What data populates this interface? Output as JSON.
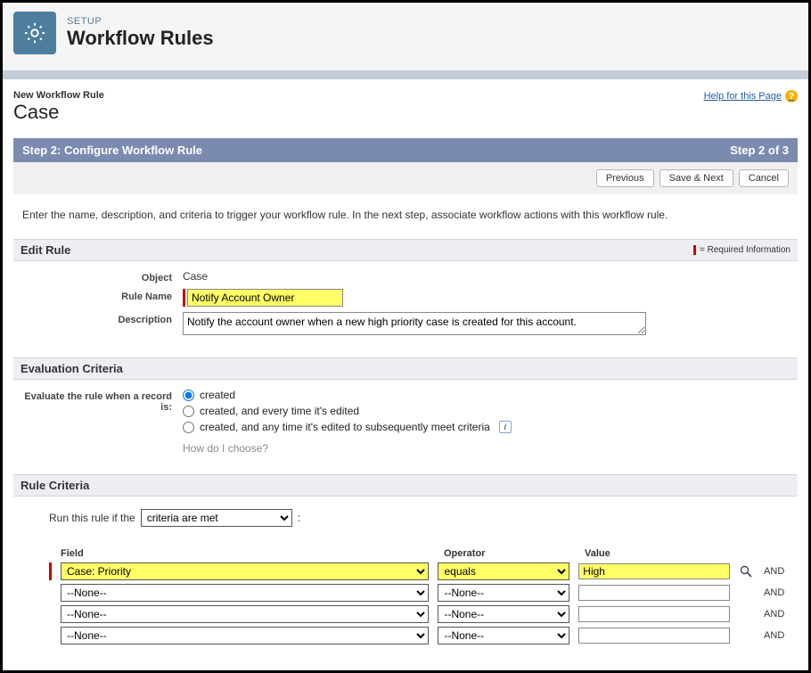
{
  "header": {
    "setup_label": "SETUP",
    "page_title": "Workflow Rules"
  },
  "breadcrumb": {
    "small": "New Workflow Rule",
    "big": "Case",
    "help_text": "Help for this Page"
  },
  "step_bar": {
    "left": "Step 2: Configure Workflow Rule",
    "right": "Step 2 of 3"
  },
  "buttons": {
    "previous": "Previous",
    "save_next": "Save & Next",
    "cancel": "Cancel"
  },
  "instructions": "Enter the name, description, and criteria to trigger your workflow rule. In the next step, associate workflow actions with this workflow rule.",
  "edit_rule": {
    "title": "Edit Rule",
    "required_info": "= Required Information",
    "object_label": "Object",
    "object_value": "Case",
    "rule_name_label": "Rule Name",
    "rule_name_value": "Notify Account Owner",
    "description_label": "Description",
    "description_value": "Notify the account owner when a new high priority case is created for this account."
  },
  "eval": {
    "title": "Evaluation Criteria",
    "label": "Evaluate the rule when a record is:",
    "option1": "created",
    "option2": "created, and every time it's edited",
    "option3": "created, and any time it's edited to subsequently meet criteria",
    "help": "How do I choose?"
  },
  "criteria": {
    "title": "Rule Criteria",
    "run_label": "Run this rule if the",
    "run_select": "criteria are met",
    "col_field": "Field",
    "col_op": "Operator",
    "col_val": "Value",
    "and": "AND",
    "rows": [
      {
        "field": "Case: Priority",
        "op": "equals",
        "val": "High",
        "hl": true,
        "req": true,
        "lookup": true
      },
      {
        "field": "--None--",
        "op": "--None--",
        "val": "",
        "hl": false,
        "req": false,
        "lookup": false
      },
      {
        "field": "--None--",
        "op": "--None--",
        "val": "",
        "hl": false,
        "req": false,
        "lookup": false
      },
      {
        "field": "--None--",
        "op": "--None--",
        "val": "",
        "hl": false,
        "req": false,
        "lookup": false
      }
    ]
  }
}
